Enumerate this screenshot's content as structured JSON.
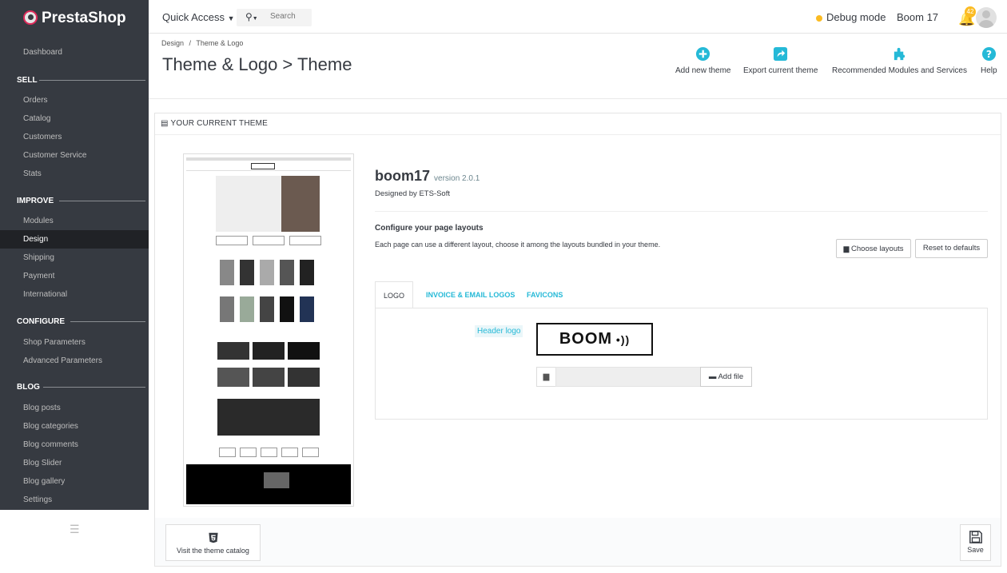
{
  "brand": {
    "name": "PrestaShop"
  },
  "topbar": {
    "quick_access": "Quick Access",
    "search_placeholder": "Search",
    "debug_mode": "Debug mode",
    "shop_name": "Boom 17",
    "notifications_count": "42"
  },
  "sidebar": {
    "dashboard": "Dashboard",
    "sections": [
      {
        "title": "SELL",
        "items": [
          "Orders",
          "Catalog",
          "Customers",
          "Customer Service",
          "Stats"
        ]
      },
      {
        "title": "IMPROVE",
        "items": [
          "Modules",
          "Design",
          "Shipping",
          "Payment",
          "International"
        ]
      },
      {
        "title": "CONFIGURE",
        "items": [
          "Shop Parameters",
          "Advanced Parameters"
        ]
      },
      {
        "title": "BLOG",
        "items": [
          "Blog posts",
          "Blog categories",
          "Blog comments",
          "Blog Slider",
          "Blog gallery",
          "Settings"
        ]
      }
    ],
    "active_item": "Design"
  },
  "header": {
    "breadcrumb_parent": "Design",
    "breadcrumb_sep": "/",
    "breadcrumb_current": "Theme & Logo",
    "title": "Theme & Logo > Theme",
    "toolbar": {
      "add_theme": "Add new theme",
      "export_theme": "Export current theme",
      "recommended": "Recommended Modules and Services",
      "help": "Help"
    }
  },
  "panel": {
    "heading": "YOUR CURRENT THEME",
    "theme_name": "boom17",
    "theme_version": "version 2.0.1",
    "designed_by": "Designed by ETS-Soft",
    "layouts_title": "Configure your page layouts",
    "layouts_desc": "Each page can use a different layout, choose it among the layouts bundled in your theme.",
    "choose_layouts": "Choose layouts",
    "reset_defaults": "Reset to defaults",
    "tabs": [
      "LOGO",
      "INVOICE & EMAIL LOGOS",
      "FAVICONS"
    ],
    "header_logo_label": "Header logo",
    "logo_text": "BOOM",
    "add_file": "Add file",
    "visit_catalog": "Visit the theme catalog",
    "save": "Save"
  },
  "colors": {
    "sidebar_bg": "#363a41",
    "accent": "#25b9d7",
    "debug_dot": "#fbbb22",
    "brand_pink": "#dd2a5a"
  }
}
